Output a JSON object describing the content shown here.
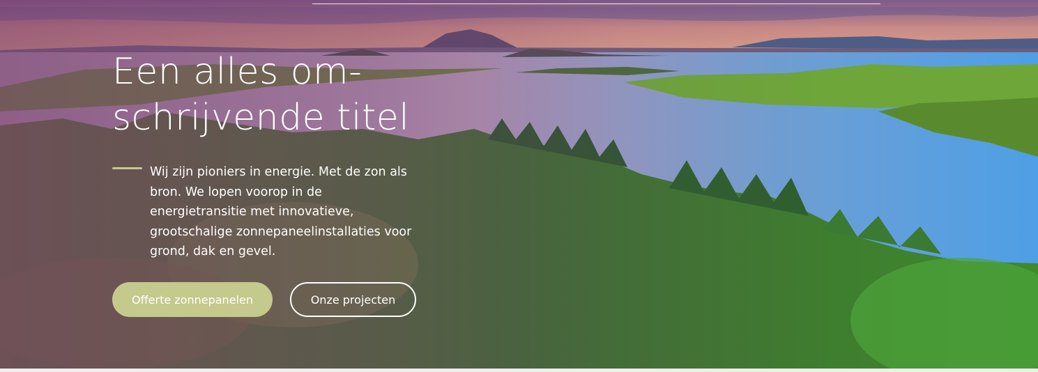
{
  "hero": {
    "title": "Een alles om-schrijvende titel",
    "lead": "Wij zijn pioniers in energie. Met de zon als bron. We lopen voorop in de energietransitie met innovatieve, grootschalige zonnepaneelinstallaties voor grond, dak en gevel.",
    "buttons": {
      "primary_label": "Offerte zonnepanelen",
      "secondary_label": "Onze projecten"
    },
    "background_image": "lake-landscape-with-forest-at-sunset"
  },
  "colors": {
    "accent": "#c4c98c",
    "overlay": "#783c6e",
    "text": "#ffffff"
  }
}
